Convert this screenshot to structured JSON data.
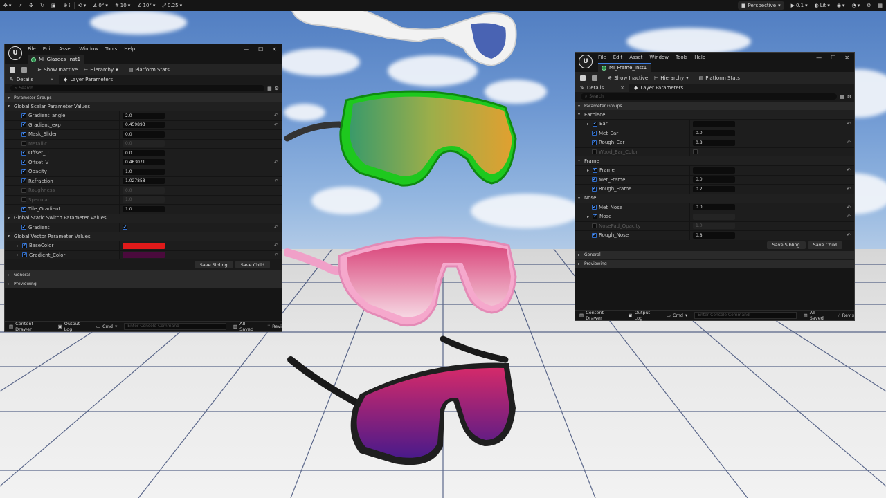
{
  "viewport": {
    "toolbar": {
      "snap_angle": "0°",
      "grid_snap": "10",
      "rotation_snap": "10°",
      "scale_snap": "0.25",
      "view_mode_label": "Perspective",
      "speed_label": "0.1",
      "lit_label": "Lit"
    }
  },
  "windows": {
    "left": {
      "menu": [
        "File",
        "Edit",
        "Asset",
        "Window",
        "Tools",
        "Help"
      ],
      "tab_title": "MI_Glasees_Inst1",
      "toolbar": {
        "show_inactive": "Show Inactive",
        "hierarchy": "Hierarchy",
        "platform_stats": "Platform Stats"
      },
      "panel_tabs": {
        "details": "Details",
        "layer_parameters": "Layer Parameters"
      },
      "search_placeholder": "Search",
      "parameter_groups": "Parameter Groups",
      "scalar_header": "Global Scalar Parameter Values",
      "scalars": [
        {
          "name": "Gradient_angle",
          "value": "2.0",
          "enabled": true,
          "reset": true
        },
        {
          "name": "Gradient_exp",
          "value": "0.459893",
          "enabled": true,
          "reset": true
        },
        {
          "name": "Mask_Slider",
          "value": "0.0",
          "enabled": true,
          "reset": false
        },
        {
          "name": "Metallic",
          "value": "0.0",
          "enabled": false,
          "reset": false
        },
        {
          "name": "Offset_U",
          "value": "0.0",
          "enabled": true,
          "reset": false
        },
        {
          "name": "Offset_V",
          "value": "0.463071",
          "enabled": true,
          "reset": true
        },
        {
          "name": "Opacity",
          "value": "1.0",
          "enabled": true,
          "reset": false
        },
        {
          "name": "Refraction",
          "value": "1.027858",
          "enabled": true,
          "reset": true
        },
        {
          "name": "Roughness",
          "value": "0.0",
          "enabled": false,
          "reset": false
        },
        {
          "name": "Specular",
          "value": "1.0",
          "enabled": false,
          "reset": false
        },
        {
          "name": "Tile_Gradient",
          "value": "1.0",
          "enabled": true,
          "reset": false
        }
      ],
      "switch_header": "Global Static Switch Parameter Values",
      "switches": [
        {
          "name": "Gradient",
          "checked": true
        }
      ],
      "vector_header": "Global Vector Parameter Values",
      "vectors": [
        {
          "name": "BaseColor",
          "color": "#e01a1a"
        },
        {
          "name": "Gradient_Color",
          "color": "#4a0a3c"
        }
      ],
      "save_sibling": "Save Sibling",
      "save_child": "Save Child",
      "general": "General",
      "previewing": "Previewing",
      "status": {
        "content_drawer": "Content Drawer",
        "output_log": "Output Log",
        "cmd": "Cmd",
        "console_placeholder": "Enter Console Command",
        "all_saved": "All Saved",
        "revision": "Revi"
      }
    },
    "right": {
      "menu": [
        "File",
        "Edit",
        "Asset",
        "Window",
        "Tools",
        "Help"
      ],
      "tab_title": "MI_Frame_Inst1",
      "toolbar": {
        "show_inactive": "Show Inactive",
        "hierarchy": "Hierarchy",
        "platform_stats": "Platform Stats"
      },
      "panel_tabs": {
        "details": "Details",
        "layer_parameters": "Layer Parameters"
      },
      "search_placeholder": "Search",
      "parameter_groups": "Parameter Groups",
      "groups": [
        {
          "name": "Earpiece",
          "params": [
            {
              "name": "Ear",
              "type": "texture",
              "enabled": true,
              "expandable": true,
              "reset": true
            },
            {
              "name": "Met_Ear",
              "type": "num",
              "value": "0.0",
              "enabled": true,
              "reset": false
            },
            {
              "name": "Rough_Ear",
              "type": "num",
              "value": "0.8",
              "enabled": true,
              "reset": true
            },
            {
              "name": "Wood_Ear_Color",
              "type": "check",
              "enabled": false,
              "reset": false
            }
          ]
        },
        {
          "name": "Frame",
          "params": [
            {
              "name": "Frame",
              "type": "texture",
              "enabled": true,
              "expandable": true,
              "reset": true
            },
            {
              "name": "Met_Frame",
              "type": "num",
              "value": "0.0",
              "enabled": true,
              "reset": false
            },
            {
              "name": "Rough_Frame",
              "type": "num",
              "value": "0.2",
              "enabled": true,
              "reset": true
            }
          ]
        },
        {
          "name": "Nose",
          "params": [
            {
              "name": "Met_Nose",
              "type": "num",
              "value": "0.0",
              "enabled": true,
              "reset": true
            },
            {
              "name": "Nose",
              "type": "texture-dim",
              "enabled": true,
              "expandable": true,
              "reset": true
            },
            {
              "name": "NosePad_Opacity",
              "type": "num",
              "value": "1.0",
              "enabled": false,
              "reset": false
            },
            {
              "name": "Rough_Nose",
              "type": "num",
              "value": "0.8",
              "enabled": true,
              "reset": true
            }
          ]
        }
      ],
      "save_sibling": "Save Sibling",
      "save_child": "Save Child",
      "general": "General",
      "previewing": "Previewing",
      "status": {
        "content_drawer": "Content Drawer",
        "output_log": "Output Log",
        "cmd": "Cmd",
        "console_placeholder": "Enter Console Command",
        "all_saved": "All Saved",
        "revision": "Revis"
      }
    }
  }
}
